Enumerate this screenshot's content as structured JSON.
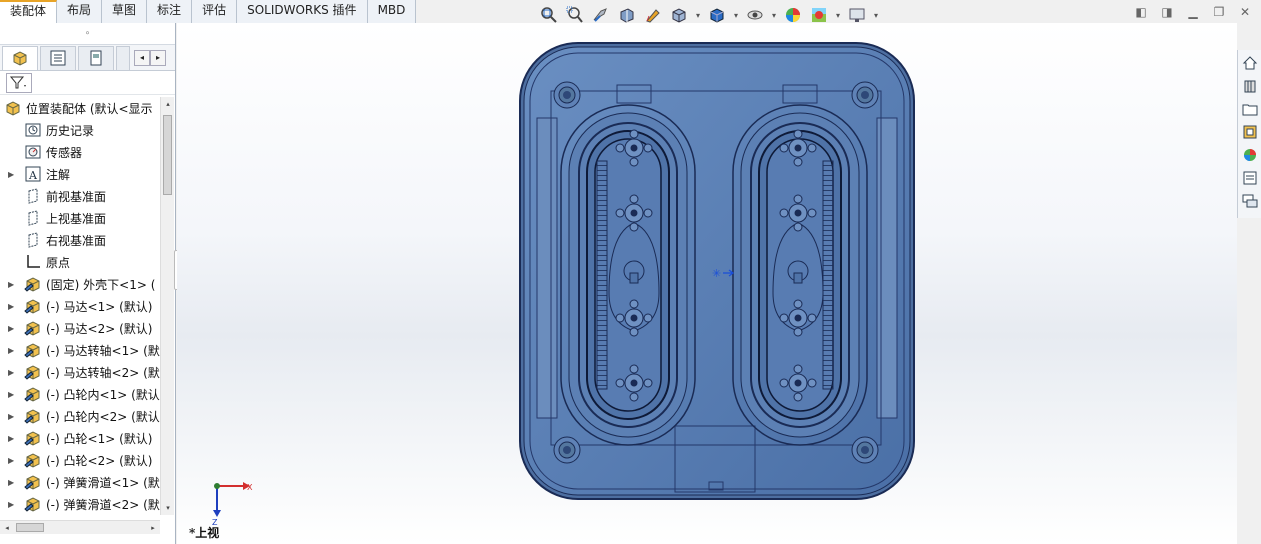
{
  "command_tabs": [
    "装配体",
    "布局",
    "草图",
    "标注",
    "评估",
    "SOLIDWORKS 插件",
    "MBD"
  ],
  "active_tab": 0,
  "hud_icons": [
    "zoom-to-fit-icon",
    "zoom-to-area-icon",
    "previous-view-icon",
    "section-view-icon",
    "dynamic-annotation-icon",
    "view-orientation-icon",
    "display-style-icon",
    "hide-show-icon",
    "edit-appearance-icon",
    "apply-scene-icon",
    "view-settings-icon"
  ],
  "feature_tree": {
    "root_label": "位置装配体  (默认<显示",
    "items": [
      {
        "label": "历史记录",
        "icon": "history-icon",
        "arrow": false
      },
      {
        "label": "传感器",
        "icon": "sensor-icon",
        "arrow": false
      },
      {
        "label": "注解",
        "icon": "annotation-icon",
        "arrow": true
      },
      {
        "label": "前视基准面",
        "icon": "plane-icon",
        "arrow": false
      },
      {
        "label": "上视基准面",
        "icon": "plane-icon",
        "arrow": false
      },
      {
        "label": "右视基准面",
        "icon": "plane-icon",
        "arrow": false
      },
      {
        "label": "原点",
        "icon": "origin-icon",
        "arrow": false
      },
      {
        "label": "(固定) 外壳下<1> (",
        "icon": "part-icon",
        "arrow": true
      },
      {
        "label": "(-) 马达<1> (默认)",
        "icon": "part-icon",
        "arrow": true
      },
      {
        "label": "(-) 马达<2> (默认)",
        "icon": "part-icon",
        "arrow": true
      },
      {
        "label": "(-) 马达转轴<1> (默",
        "icon": "part-icon",
        "arrow": true
      },
      {
        "label": "(-) 马达转轴<2> (默",
        "icon": "part-icon",
        "arrow": true
      },
      {
        "label": "(-) 凸轮内<1> (默认",
        "icon": "part-icon",
        "arrow": true
      },
      {
        "label": "(-) 凸轮内<2> (默认",
        "icon": "part-icon",
        "arrow": true
      },
      {
        "label": "(-) 凸轮<1> (默认)",
        "icon": "part-icon",
        "arrow": true
      },
      {
        "label": "(-) 凸轮<2> (默认)",
        "icon": "part-icon",
        "arrow": true
      },
      {
        "label": "(-) 弹簧滑道<1> (默",
        "icon": "part-icon",
        "arrow": true
      },
      {
        "label": "(-) 弹簧滑道<2> (默",
        "icon": "part-icon",
        "arrow": true
      }
    ]
  },
  "viewport": {
    "view_name": "*上视",
    "triad_x": "X",
    "triad_z": "Z"
  },
  "colors": {
    "body_blue": "#5a80b4",
    "edge_dark": "#1a2b55",
    "accent_tab": "#e8a427"
  },
  "task_pane_icons": [
    "home-icon",
    "design-library-icon",
    "file-explorer-icon",
    "view-palette-icon",
    "appearances-icon",
    "custom-properties-icon",
    "forum-icon"
  ]
}
